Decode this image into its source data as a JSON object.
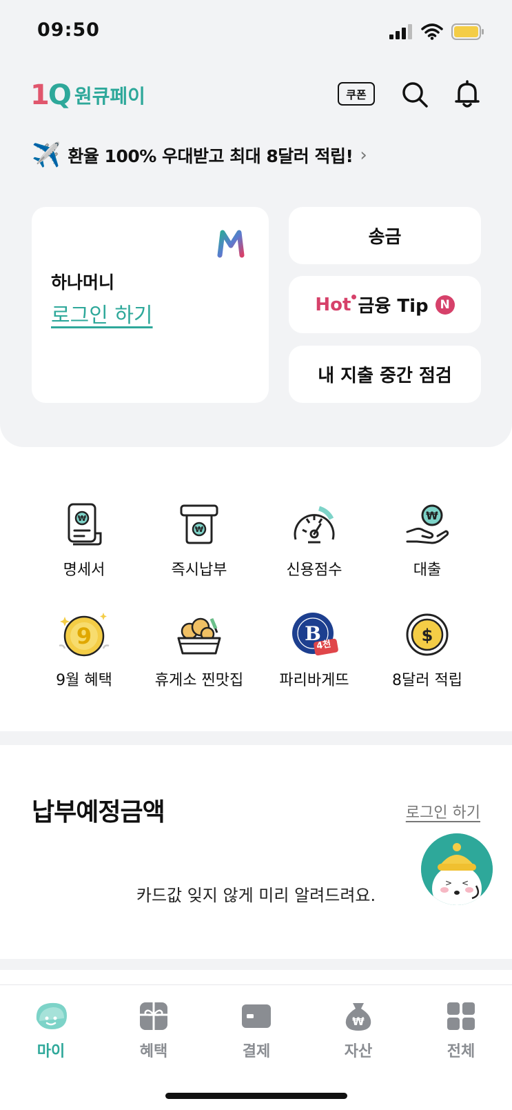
{
  "status_bar": {
    "time": "09:50"
  },
  "header": {
    "logo_mark_one": "1",
    "logo_mark_q": "Q",
    "logo_text": "원큐페이",
    "coupon_label": "쿠폰"
  },
  "promo": {
    "text": "환율 100% 우대받고 최대 8달러 적립!",
    "chevron": "›"
  },
  "login_card": {
    "title": "하나머니",
    "link": "로그인 하기"
  },
  "quick_cards": {
    "send": "송금",
    "tip_hot": "Hot",
    "tip_label": "금융 Tip",
    "tip_badge": "N",
    "check": "내 지출 중간 점검"
  },
  "menu": [
    {
      "label": "명세서",
      "icon": "receipt-icon"
    },
    {
      "label": "즉시납부",
      "icon": "instant-pay-icon"
    },
    {
      "label": "신용점수",
      "icon": "credit-gauge-icon"
    },
    {
      "label": "대출",
      "icon": "loan-hand-icon"
    },
    {
      "label": "9월 혜택",
      "icon": "gold-coin-9-icon"
    },
    {
      "label": "휴게소 찐맛집",
      "icon": "food-bowl-icon"
    },
    {
      "label": "파리바게뜨",
      "icon": "paris-baguette-icon",
      "badge": "4천"
    },
    {
      "label": "8달러 적립",
      "icon": "dollar-coin-icon"
    }
  ],
  "payment": {
    "title": "납부예정금액",
    "login_link": "로그인 하기",
    "message": "카드값 잊지 않게 미리 알려드려요."
  },
  "tabs": [
    {
      "label": "마이",
      "icon": "my-icon",
      "active": true
    },
    {
      "label": "혜택",
      "icon": "gift-icon",
      "active": false
    },
    {
      "label": "결제",
      "icon": "card-icon",
      "active": false
    },
    {
      "label": "자산",
      "icon": "money-bag-icon",
      "active": false
    },
    {
      "label": "전체",
      "icon": "grid-icon",
      "active": false
    }
  ],
  "colors": {
    "brand_teal": "#2ea89a",
    "accent_pink": "#d6416a",
    "background_gray": "#f2f3f5"
  }
}
